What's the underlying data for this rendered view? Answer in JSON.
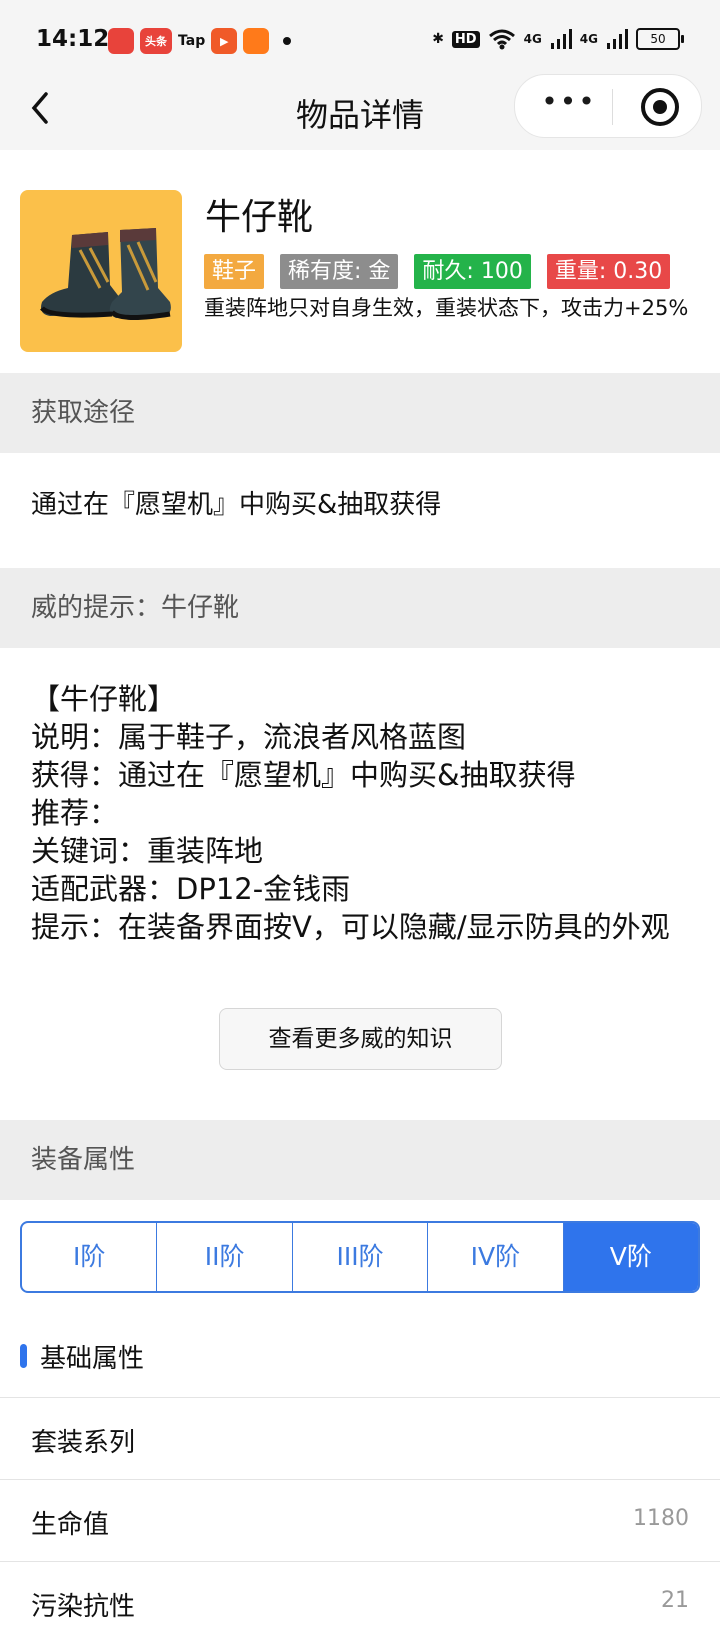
{
  "status_bar": {
    "time": "14:12",
    "app_icons": [
      {
        "name": "game-app-icon",
        "label": "",
        "color": "#e8433b"
      },
      {
        "name": "toutiao-app-icon",
        "label": "头条",
        "color": "#e8433b"
      },
      {
        "name": "taptap-app-icon",
        "label": "Tap",
        "color": "#111111"
      },
      {
        "name": "video-app-icon",
        "label": "▶",
        "color": "#f05a28"
      },
      {
        "name": "orange-app-icon",
        "label": "",
        "color": "#ff7a1a"
      }
    ],
    "hd_label": "HD",
    "network": [
      "4G",
      "4G"
    ],
    "battery": "50"
  },
  "titlebar": {
    "title": "物品详情",
    "back_glyph": "〈",
    "more_glyph": "•••"
  },
  "item": {
    "name": "牛仔靴",
    "tags": {
      "type": "鞋子",
      "rarity": "稀有度: 金",
      "durability": "耐久: 100",
      "weight": "重量: 0.30"
    },
    "description": "重装阵地只对自身生效，重装状态下，攻击力+25%",
    "image_bg": "#fbc04a"
  },
  "sections": {
    "acquire_title": "获取途径",
    "acquire_text": "通过在『愿望机』中购买&抽取获得",
    "tips_title": "威的提示：牛仔靴",
    "tips_lines": [
      "【牛仔靴】",
      "说明：属于鞋子，流浪者风格蓝图",
      "获得：通过在『愿望机』中购买&抽取获得",
      "推荐：",
      "关键词：重装阵地",
      "适配武器：DP12-金钱雨",
      "提示：在装备界面按V，可以隐藏/显示防具的外观"
    ],
    "more_button": "查看更多威的知识",
    "attrs_title": "装备属性"
  },
  "tiers": [
    "I阶",
    "II阶",
    "III阶",
    "IV阶",
    "V阶"
  ],
  "active_tier": "V阶",
  "base_attrs": {
    "title": "基础属性",
    "rows": [
      {
        "label": "套装系列",
        "value": ""
      },
      {
        "label": "生命值",
        "value": "1180"
      },
      {
        "label": "污染抗性",
        "value": "21"
      }
    ]
  },
  "colors": {
    "accent": "#2f74ec",
    "tag_type": "#f3a940",
    "tag_rarity": "#8d8d8d",
    "tag_durability": "#24b34a",
    "tag_weight": "#e84848"
  }
}
